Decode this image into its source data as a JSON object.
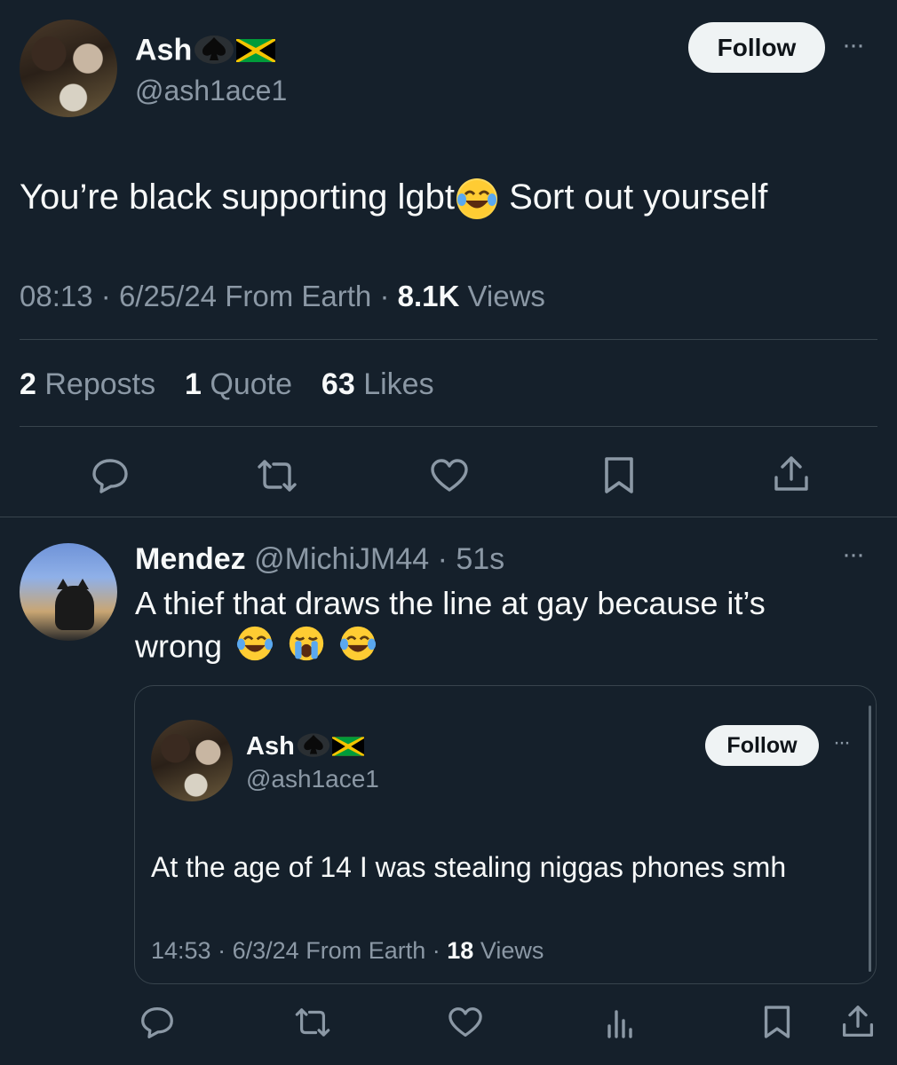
{
  "main_tweet": {
    "author": {
      "name": "Ash",
      "handle": "@ash1ace1"
    },
    "follow_label": "Follow",
    "more_label": "···",
    "text_part1": "You’re black supporting lgbt",
    "text_part2": " Sort out yourself",
    "meta": {
      "time": "08:13",
      "date": "6/25/24",
      "source": "From Earth",
      "views_count": "8.1K",
      "views_label": "Views",
      "sep": "·"
    },
    "stats": {
      "reposts_count": "2",
      "reposts_label": "Reposts",
      "quote_count": "1",
      "quote_label": "Quote",
      "likes_count": "63",
      "likes_label": "Likes"
    }
  },
  "reply": {
    "author": {
      "name": "Mendez",
      "handle": "@MichiJM44",
      "time": "51s"
    },
    "more_label": "···",
    "text_line1": "A thief that draws the line at gay because it’s",
    "text_line2": "wrong",
    "quoted": {
      "author": {
        "name": "Ash",
        "handle": "@ash1ace1"
      },
      "follow_label": "Follow",
      "more_label": "···",
      "text": "At the age of 14 I was stealing niggas phones smh",
      "meta": {
        "time": "14:53",
        "date": "6/3/24",
        "source": "From Earth",
        "views_count": "18",
        "views_label": "Views",
        "sep": "·"
      }
    }
  },
  "colors": {
    "background": "#15202b",
    "text": "#f7f9f9",
    "muted": "#8b98a5",
    "divider": "#38444d"
  },
  "icons": [
    "reply-icon",
    "repost-icon",
    "like-icon",
    "bookmark-icon",
    "share-icon",
    "views-icon",
    "spade-icon",
    "jamaica-flag-icon"
  ]
}
